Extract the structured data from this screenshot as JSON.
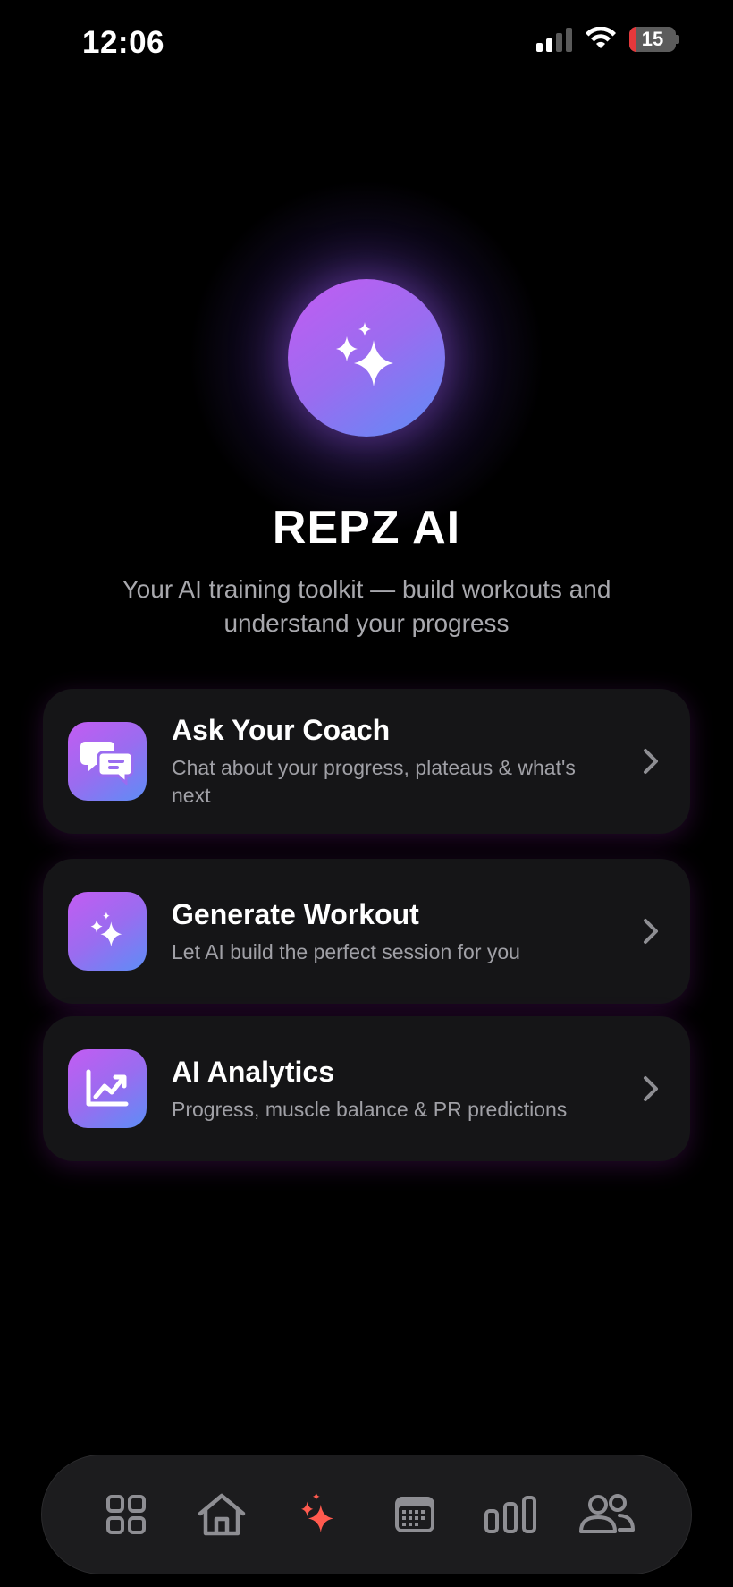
{
  "status_bar": {
    "time": "12:06",
    "battery_level": "15",
    "battery_fill_fraction": 0.15,
    "icons": [
      "signal-icon",
      "wifi-icon",
      "battery-icon"
    ]
  },
  "hero": {
    "icon": "sparkles-icon",
    "title": "REPZ AI",
    "subtitle": "Your AI training toolkit — build workouts and understand your progress"
  },
  "cards": [
    {
      "icon": "chat-bubbles-icon",
      "title": "Ask Your Coach",
      "description": "Chat about your progress, plateaus & what's next"
    },
    {
      "icon": "sparkles-icon",
      "title": "Generate Workout",
      "description": "Let AI build the perfect session for you"
    },
    {
      "icon": "trend-chart-icon",
      "title": "AI Analytics",
      "description": "Progress, muscle balance & PR predictions"
    }
  ],
  "tab_bar": {
    "items": [
      {
        "icon": "grid-icon",
        "active": false
      },
      {
        "icon": "home-icon",
        "active": false
      },
      {
        "icon": "sparkles-icon",
        "active": true
      },
      {
        "icon": "calendar-icon",
        "active": false
      },
      {
        "icon": "bar-chart-icon",
        "active": false
      },
      {
        "icon": "people-icon",
        "active": false
      }
    ]
  },
  "colors": {
    "background": "#000000",
    "card": "#151517",
    "accent_start": "#c35cf2",
    "accent_end": "#5d8df6",
    "active_tab": "#ff5a4e",
    "inactive_tab": "#8e8e93",
    "secondary_text": "#a0a0a6"
  }
}
